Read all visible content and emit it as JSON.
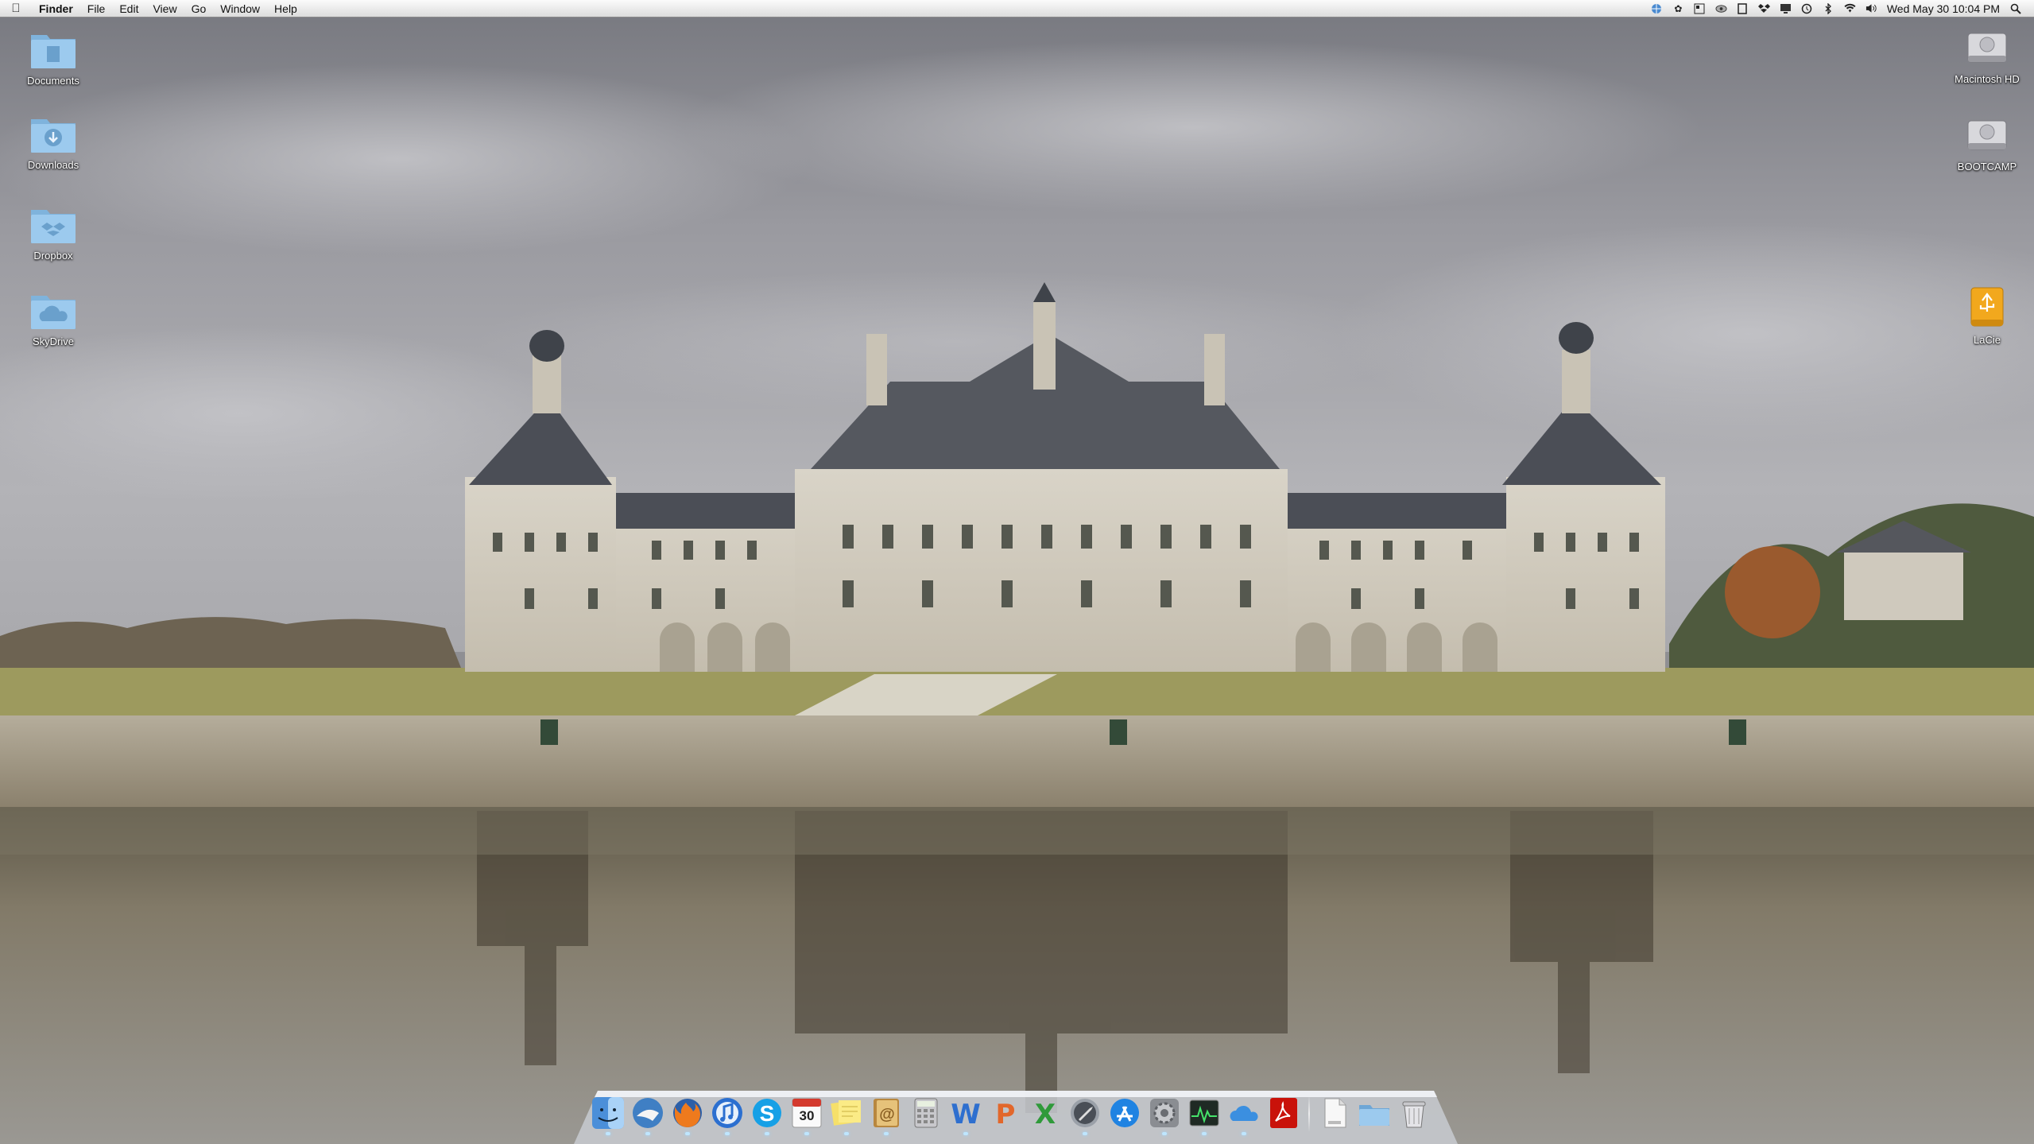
{
  "menubar": {
    "app_name": "Finder",
    "menus": [
      "File",
      "Edit",
      "View",
      "Go",
      "Window",
      "Help"
    ],
    "status_icons": [
      "vpn-globe-icon",
      "paw-icon",
      "grid-icon",
      "eye-icon",
      "window-icon",
      "dropbox-icon",
      "display-icon",
      "time-machine-icon",
      "bluetooth-icon",
      "wifi-icon",
      "volume-icon"
    ],
    "clock": "Wed May 30  10:04 PM"
  },
  "desktop": {
    "left_icons": [
      {
        "label": "Documents",
        "icon": "documents-folder-icon"
      },
      {
        "label": "Downloads",
        "icon": "downloads-folder-icon"
      },
      {
        "label": "Dropbox",
        "icon": "dropbox-folder-icon"
      },
      {
        "label": "SkyDrive",
        "icon": "skydrive-folder-icon"
      }
    ],
    "right_icons": [
      {
        "label": "Macintosh HD",
        "icon": "hard-drive-icon"
      },
      {
        "label": "BOOTCAMP",
        "icon": "hard-drive-icon"
      },
      {
        "label": "LaCie",
        "icon": "usb-drive-icon"
      }
    ]
  },
  "dock": {
    "apps": [
      {
        "name": "Finder",
        "icon": "finder-icon"
      },
      {
        "name": "Mail",
        "icon": "mail-icon"
      },
      {
        "name": "Firefox",
        "icon": "firefox-icon"
      },
      {
        "name": "iTunes",
        "icon": "itunes-icon"
      },
      {
        "name": "Skype",
        "icon": "skype-icon"
      },
      {
        "name": "iCal",
        "icon": "calendar-icon",
        "text": "30"
      },
      {
        "name": "Stickies",
        "icon": "stickies-icon"
      },
      {
        "name": "Address Book",
        "icon": "address-book-icon"
      },
      {
        "name": "Calculator",
        "icon": "calculator-icon"
      },
      {
        "name": "Word",
        "icon": "word-icon",
        "text": "W"
      },
      {
        "name": "PowerPoint",
        "icon": "powerpoint-icon",
        "text": "P"
      },
      {
        "name": "Excel",
        "icon": "excel-icon",
        "text": "X"
      },
      {
        "name": "Launchpad",
        "icon": "launchpad-icon"
      },
      {
        "name": "App Store",
        "icon": "app-store-icon"
      },
      {
        "name": "System Preferences",
        "icon": "system-preferences-icon"
      },
      {
        "name": "Activity Monitor",
        "icon": "activity-monitor-icon"
      },
      {
        "name": "SkyDrive",
        "icon": "skydrive-icon"
      },
      {
        "name": "Adobe Reader",
        "icon": "adobe-reader-icon"
      }
    ],
    "stacks": [
      {
        "name": "Documents",
        "icon": "document-stack-icon"
      },
      {
        "name": "Folder",
        "icon": "folder-stack-icon"
      },
      {
        "name": "Trash",
        "icon": "trash-icon"
      }
    ],
    "colors": {
      "shelf": "#c9cdd3",
      "running": "#bfe6ff"
    }
  }
}
